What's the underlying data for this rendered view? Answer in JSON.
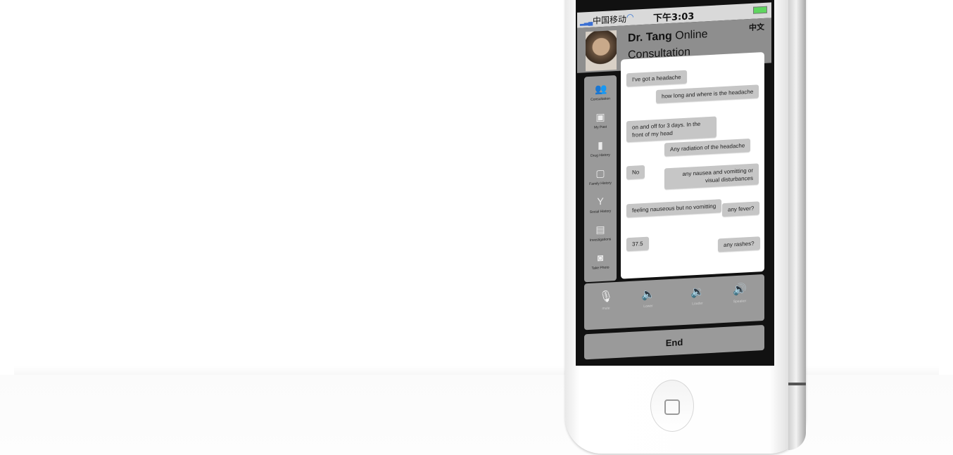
{
  "status_bar": {
    "carrier": "中国移动",
    "time": "下午3:03"
  },
  "header": {
    "doctor_name": "Dr. Tang",
    "status": "Online",
    "subtitle": "Consultation",
    "language_toggle": "中文"
  },
  "sidebar": {
    "items": [
      {
        "label": "Consultation",
        "icon": "users-icon"
      },
      {
        "label": "My Past",
        "icon": "folder-plus-icon"
      },
      {
        "label": "Drug History",
        "icon": "pill-bottle-icon"
      },
      {
        "label": "Family History",
        "icon": "person-frame-icon"
      },
      {
        "label": "Social History",
        "icon": "cocktail-icon"
      },
      {
        "label": "Investigations",
        "icon": "document-icon"
      },
      {
        "label": "Take Photo",
        "icon": "camera-icon"
      }
    ]
  },
  "chat": {
    "messages": [
      {
        "from": "patient",
        "text": "I've got a headache"
      },
      {
        "from": "doctor",
        "text": "how long and where is the headache"
      },
      {
        "from": "patient",
        "text": "on and off for 3 days. In the front of my head"
      },
      {
        "from": "doctor",
        "text": "Any radiation of the headache"
      },
      {
        "from": "patient",
        "text": "No"
      },
      {
        "from": "doctor",
        "text": "any nausea and vomitting or visual disturbances"
      },
      {
        "from": "patient",
        "text": "feeling nauseous but no vomitting"
      },
      {
        "from": "doctor",
        "text": "any fever?"
      },
      {
        "from": "patient",
        "text": "37.5"
      },
      {
        "from": "doctor",
        "text": "any rashes?"
      }
    ]
  },
  "controls": {
    "items": [
      {
        "label": "mute",
        "icon": "mic-muted-icon"
      },
      {
        "label": "Lower",
        "icon": "speaker-low-icon"
      },
      {
        "label": "Louder",
        "icon": "speaker-mid-icon"
      },
      {
        "label": "Speaker",
        "icon": "speaker-high-icon"
      }
    ],
    "end_label": "End"
  }
}
